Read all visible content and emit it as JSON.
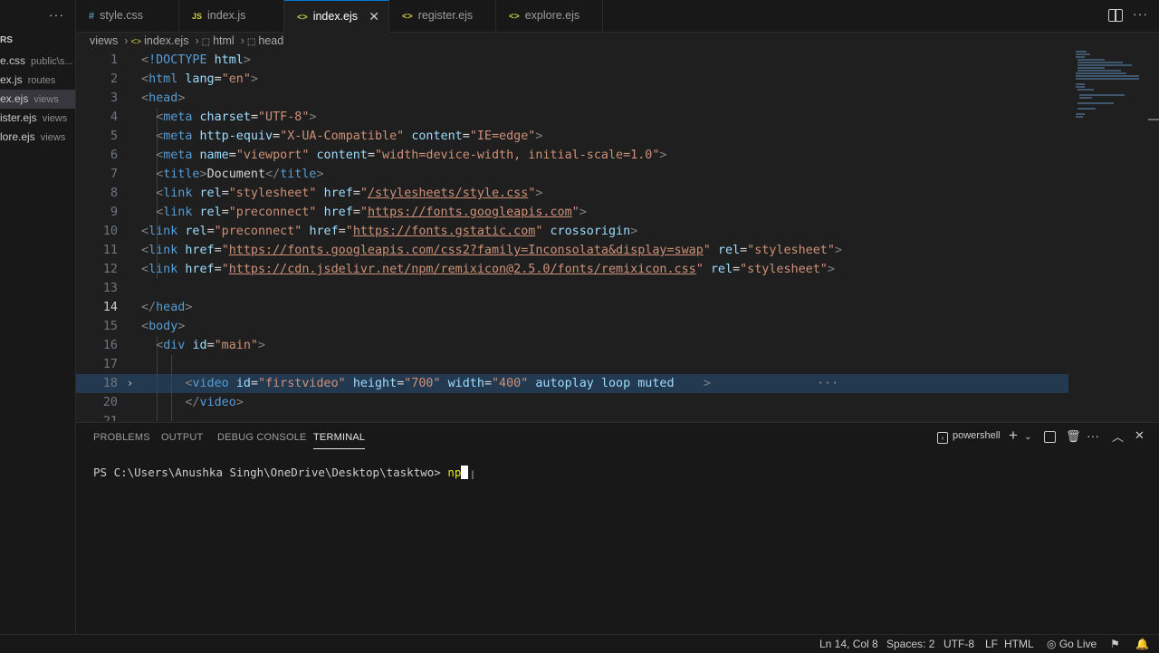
{
  "sidebar": {
    "more": "···",
    "header": "RS",
    "files": [
      {
        "name": "e.css",
        "dir": "public\\s..."
      },
      {
        "name": "ex.js",
        "dir": "routes"
      },
      {
        "name": "ex.ejs",
        "dir": "views"
      },
      {
        "name": "ister.ejs",
        "dir": "views"
      },
      {
        "name": "lore.ejs",
        "dir": "views"
      }
    ]
  },
  "tabs": [
    {
      "icon": "#",
      "label": "style.css",
      "icon_color": "#519aba"
    },
    {
      "icon": "JS",
      "label": "index.js",
      "icon_color": "#cbcb41"
    },
    {
      "icon": "<>",
      "label": "index.ejs",
      "icon_color": "#cbcb41"
    },
    {
      "icon": "<>",
      "label": "register.ejs",
      "icon_color": "#cbcb41"
    },
    {
      "icon": "<>",
      "label": "explore.ejs",
      "icon_color": "#cbcb41"
    }
  ],
  "tab_close": "✕",
  "breadcrumb": [
    "views",
    "index.ejs",
    "html",
    "head"
  ],
  "editor": {
    "line_numbers": [
      "1",
      "2",
      "3",
      "4",
      "5",
      "6",
      "7",
      "8",
      "9",
      "10",
      "11",
      "12",
      "13",
      "14",
      "15",
      "16",
      "17",
      "18",
      "20",
      "21"
    ],
    "current_line": "14",
    "folded_ellipsis": "···"
  },
  "panel": {
    "tabs": [
      "PROBLEMS",
      "OUTPUT",
      "DEBUG CONSOLE",
      "TERMINAL"
    ],
    "active_tab": "TERMINAL",
    "shell": "powershell",
    "prompt": "PS C:\\Users\\Anushka Singh\\OneDrive\\Desktop\\tasktwo> ",
    "typed": "np"
  },
  "status": {
    "position": "Ln 14, Col 8",
    "spaces": "Spaces: 2",
    "encoding": "UTF-8",
    "eol": "LF",
    "language": "HTML",
    "go_live": "Go Live"
  },
  "colors": {
    "tag": "#569cd6",
    "attr": "#9cdcfe",
    "string": "#ce9178",
    "accent": "#0078d4"
  }
}
